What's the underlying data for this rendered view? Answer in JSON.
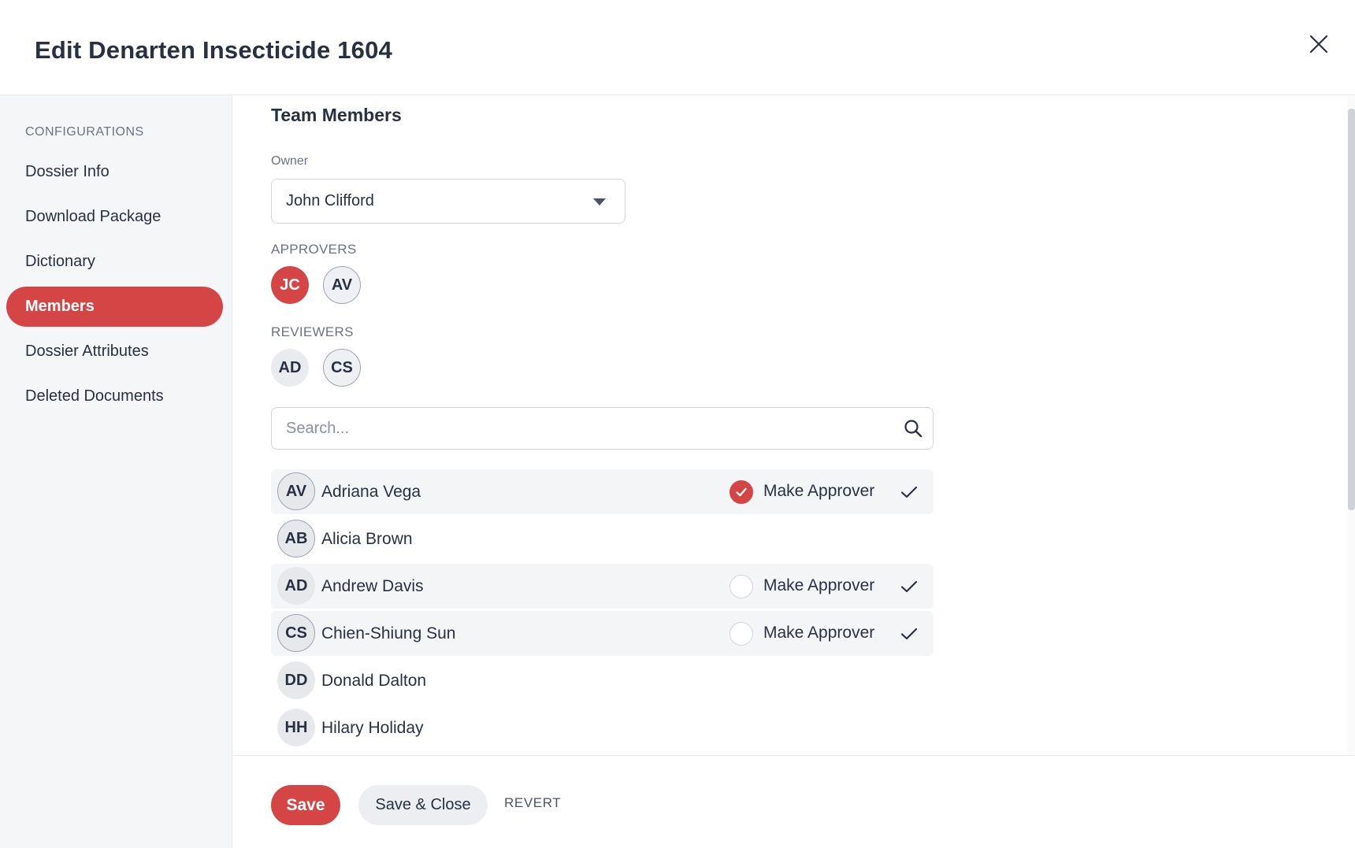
{
  "dialog": {
    "title": "Edit Denarten Insecticide 1604"
  },
  "sidebar": {
    "section_title": "CONFIGURATIONS",
    "items": [
      {
        "label": "Dossier Info"
      },
      {
        "label": "Download Package"
      },
      {
        "label": "Dictionary"
      },
      {
        "label": "Members",
        "active": true
      },
      {
        "label": "Dossier Attributes"
      },
      {
        "label": "Deleted Documents"
      }
    ]
  },
  "main": {
    "heading": "Team Members",
    "owner": {
      "label": "Owner",
      "value": "John Clifford"
    },
    "approvers": {
      "label": "APPROVERS",
      "chips": [
        "JC",
        "AV"
      ]
    },
    "reviewers": {
      "label": "REVIEWERS",
      "chips": [
        "AD",
        "CS"
      ]
    },
    "search": {
      "placeholder": "Search...",
      "value": ""
    },
    "members": [
      {
        "initials": "AV",
        "name": "Adriana Vega",
        "make_approver_label": "Make Approver",
        "is_approver": true,
        "selected": true
      },
      {
        "initials": "AB",
        "name": "Alicia Brown"
      },
      {
        "initials": "AD",
        "name": "Andrew Davis",
        "make_approver_label": "Make Approver",
        "is_approver": false,
        "selected": true
      },
      {
        "initials": "CS",
        "name": "Chien-Shiung Sun",
        "make_approver_label": "Make Approver",
        "is_approver": false,
        "selected": true
      },
      {
        "initials": "DD",
        "name": "Donald Dalton"
      },
      {
        "initials": "HH",
        "name": "Hilary Holiday"
      }
    ]
  },
  "footer": {
    "save_label": "Save",
    "save_close_label": "Save & Close",
    "revert_label": "REVERT"
  },
  "colors": {
    "accent": "#d64545",
    "text": "#283142",
    "muted": "#6b7280",
    "sidebar_bg": "#f5f6f8"
  }
}
